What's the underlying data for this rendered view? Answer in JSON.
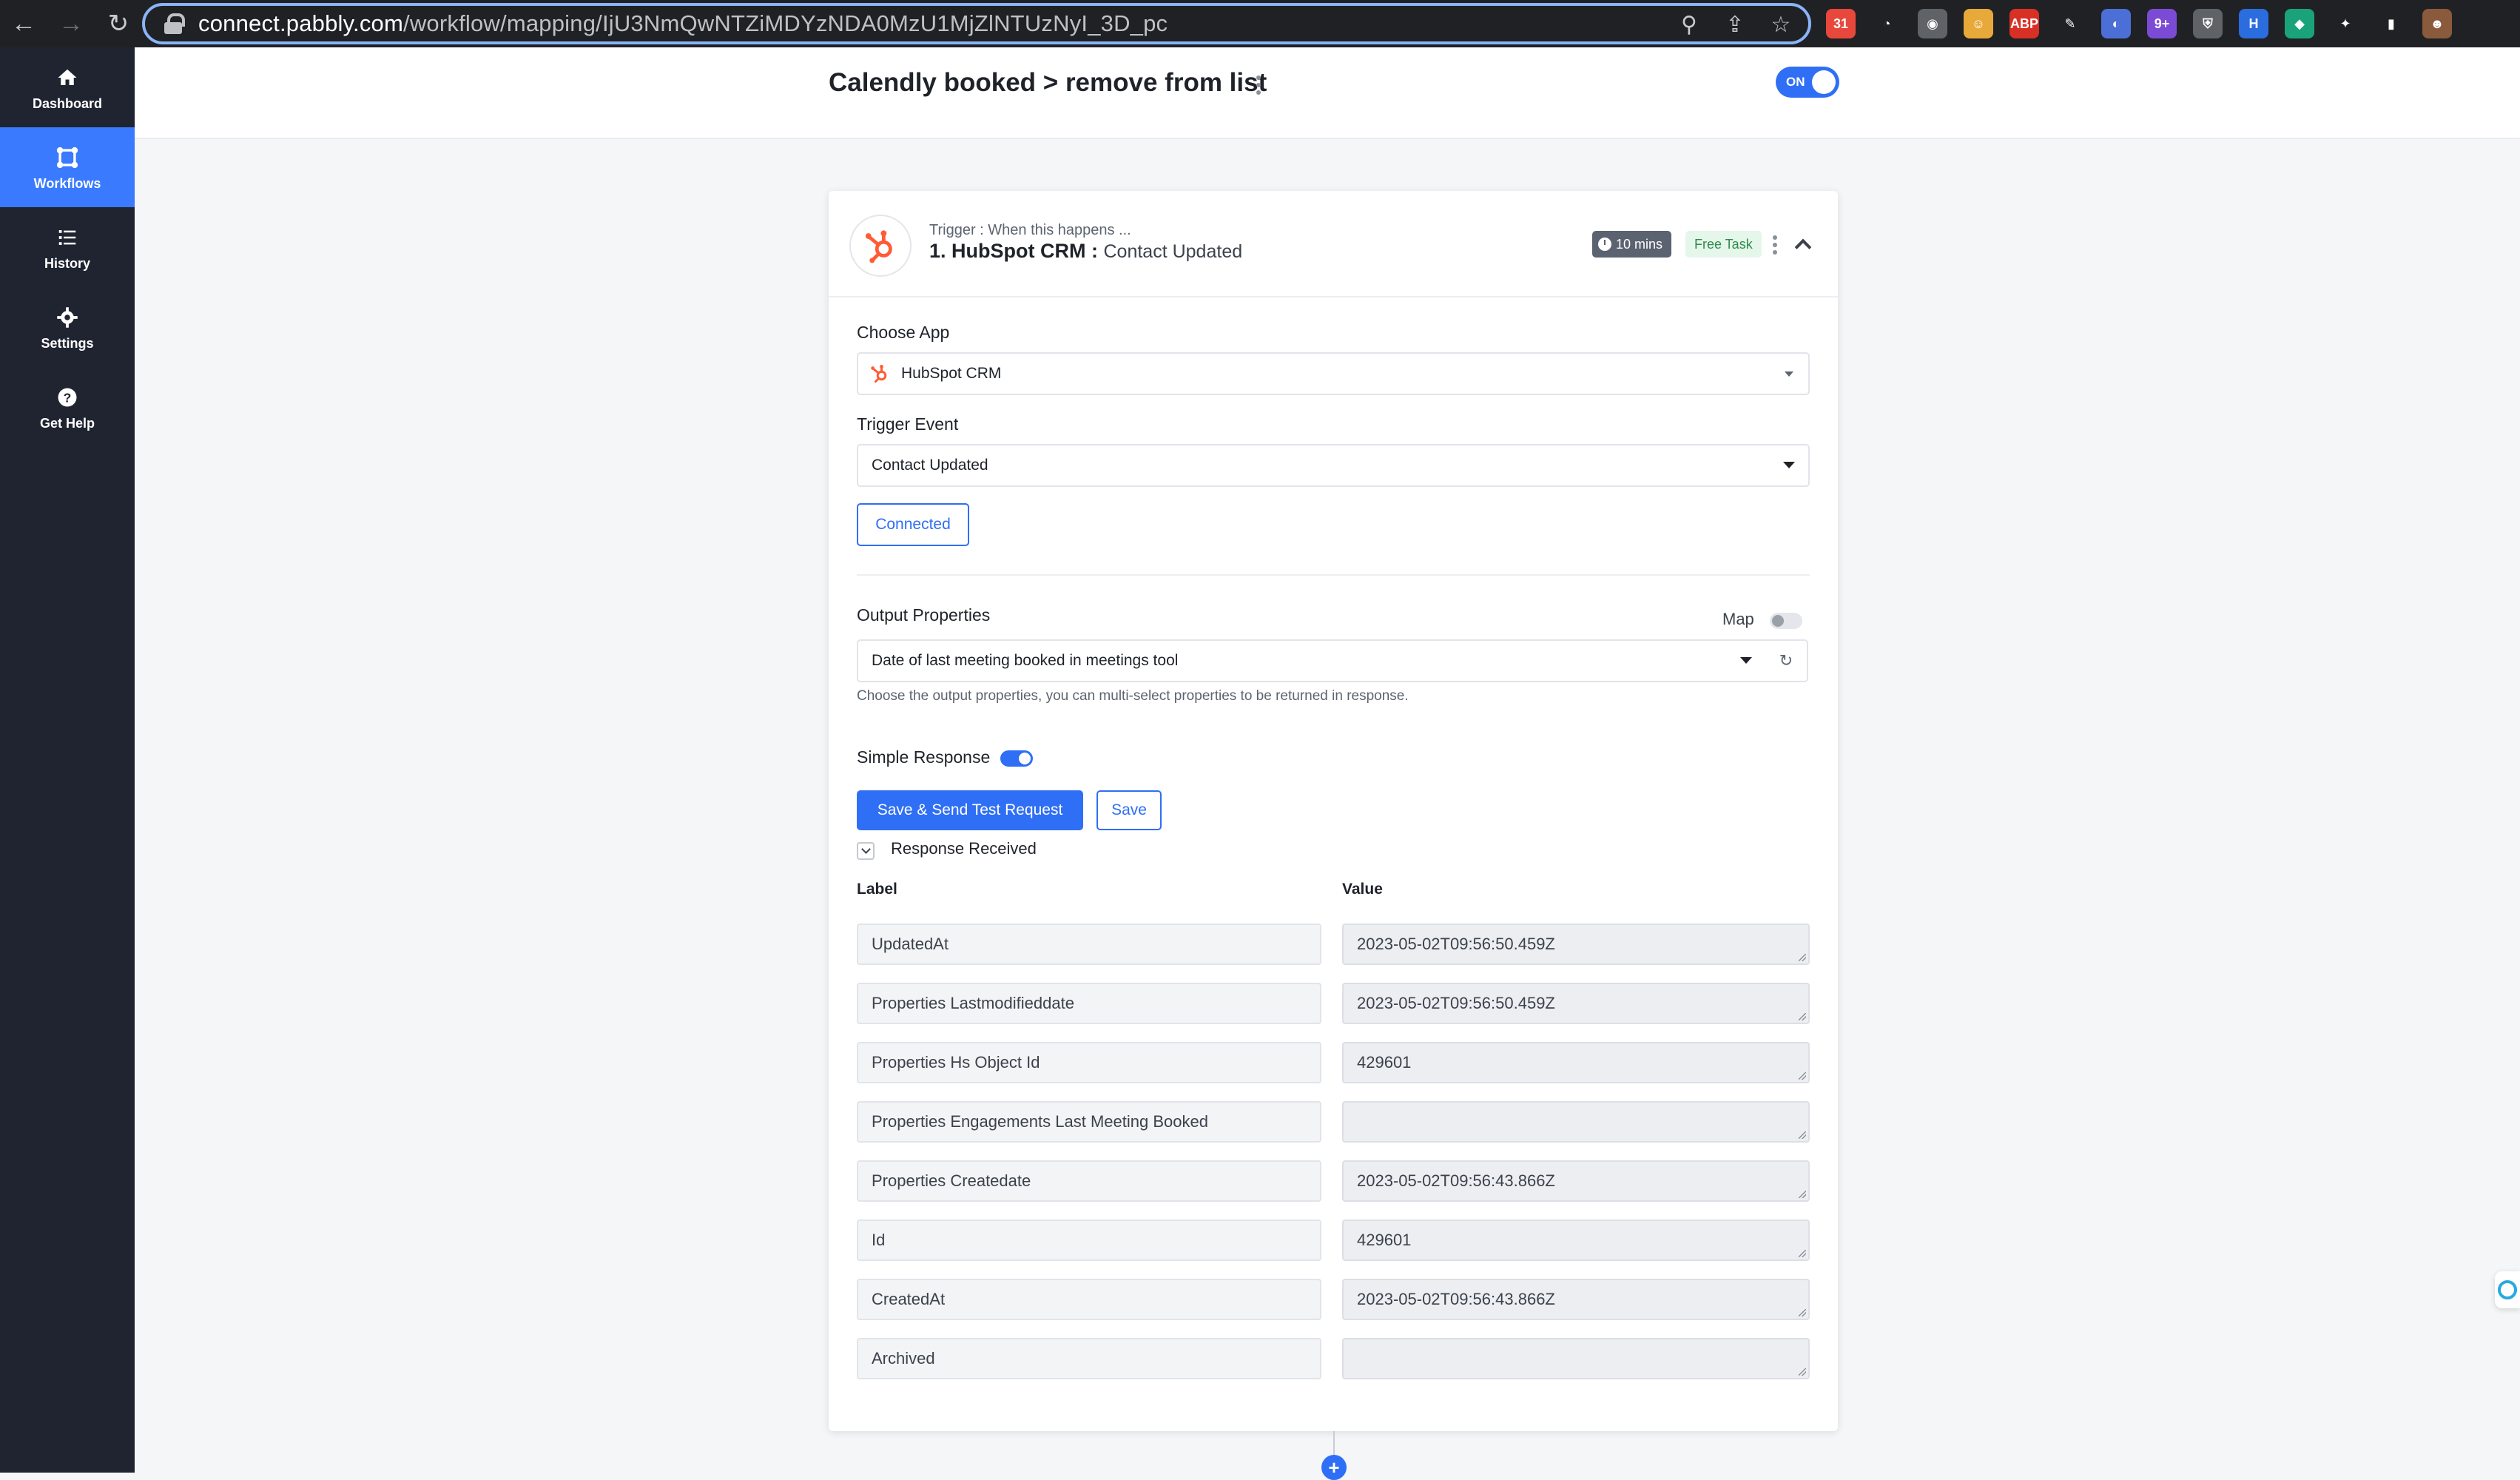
{
  "browser": {
    "url_host": "connect.pabbly.com",
    "url_path": "/workflow/mapping/IjU3NmQwNTZiMDYzNDA0MzU1MjZlNTUzNyI_3D_pc",
    "extensions": [
      {
        "name": "ext-calendar",
        "color": "#e8473c",
        "glyph": "31"
      },
      {
        "name": "ext-timer",
        "color": "#202124",
        "glyph": "◔"
      },
      {
        "name": "ext-chat",
        "color": "#5f6368",
        "glyph": "◉"
      },
      {
        "name": "ext-emoji",
        "color": "#e7a93a",
        "glyph": "☺"
      },
      {
        "name": "ext-adblock",
        "color": "#d93025",
        "glyph": "ABP"
      },
      {
        "name": "ext-pen",
        "color": "#202124",
        "glyph": "✎"
      },
      {
        "name": "ext-color",
        "color": "#4b6fd6",
        "glyph": "◐"
      },
      {
        "name": "ext-badge",
        "color": "#7b4bd6",
        "glyph": "9+"
      },
      {
        "name": "ext-shield",
        "color": "#5f6368",
        "glyph": "⛨"
      },
      {
        "name": "ext-h",
        "color": "#2b6cdf",
        "glyph": "H"
      },
      {
        "name": "ext-diamond",
        "color": "#1aa37a",
        "glyph": "◆"
      },
      {
        "name": "ext-puzzle",
        "color": "#202124",
        "glyph": "✦"
      },
      {
        "name": "ext-sidepanel",
        "color": "#202124",
        "glyph": "▮"
      },
      {
        "name": "ext-profile",
        "color": "#8a5a3c",
        "glyph": "☻"
      }
    ]
  },
  "sidebar": {
    "items": [
      {
        "label": "Dashboard",
        "icon": "home-icon",
        "glyph": "⌂"
      },
      {
        "label": "Workflows",
        "icon": "workflows-icon",
        "glyph": "⚙"
      },
      {
        "label": "History",
        "icon": "history-icon",
        "glyph": "☰"
      },
      {
        "label": "Settings",
        "icon": "gear-icon",
        "glyph": "✹"
      },
      {
        "label": "Get Help",
        "icon": "help-icon",
        "glyph": "?"
      }
    ]
  },
  "header": {
    "title": "Calendly booked > remove from list",
    "toggle_label": "ON"
  },
  "trigger": {
    "subtitle": "Trigger : When this happens ...",
    "app_name": "1. HubSpot CRM :",
    "event_name": "Contact Updated",
    "time_badge": "10 mins",
    "task_badge": "Free Task"
  },
  "form": {
    "choose_app_label": "Choose App",
    "choose_app_value": "HubSpot CRM",
    "trigger_event_label": "Trigger Event",
    "trigger_event_value": "Contact Updated",
    "connected_label": "Connected",
    "output_props_label": "Output Properties",
    "map_label": "Map",
    "output_props_value": "Date of last meeting booked in meetings tool",
    "output_props_help": "Choose the output properties, you can multi-select properties to be returned in response.",
    "simple_response_label": "Simple Response",
    "save_send_label": "Save & Send Test Request",
    "save_label": "Save",
    "response_received_label": "Response Received"
  },
  "response": {
    "label_header": "Label",
    "value_header": "Value",
    "rows": [
      {
        "label": "UpdatedAt",
        "value": "2023-05-02T09:56:50.459Z"
      },
      {
        "label": "Properties Lastmodifieddate",
        "value": "2023-05-02T09:56:50.459Z"
      },
      {
        "label": "Properties Hs Object Id",
        "value": "429601"
      },
      {
        "label": "Properties Engagements Last Meeting Booked",
        "value": ""
      },
      {
        "label": "Properties Createdate",
        "value": "2023-05-02T09:56:43.866Z"
      },
      {
        "label": "Id",
        "value": "429601"
      },
      {
        "label": "CreatedAt",
        "value": "2023-05-02T09:56:43.866Z"
      },
      {
        "label": "Archived",
        "value": ""
      }
    ]
  },
  "colors": {
    "accent": "#2f6ff5",
    "sidebar_bg": "#1f2430",
    "sidebar_active": "#3a7afe",
    "hubspot_orange": "#ff5c35"
  }
}
